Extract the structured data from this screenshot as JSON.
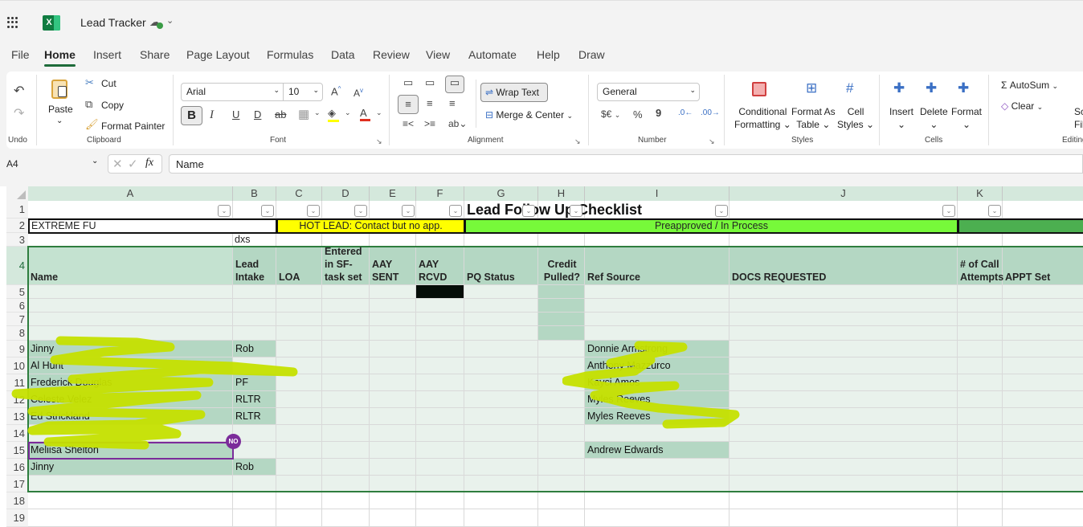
{
  "app": {
    "title": "Lead Tracker",
    "logo_letter": "X",
    "save_status": "saved-to-cloud"
  },
  "menu_tabs": [
    {
      "label": "File",
      "active": false
    },
    {
      "label": "Home",
      "active": true
    },
    {
      "label": "Insert",
      "active": false
    },
    {
      "label": "Share",
      "active": false
    },
    {
      "label": "Page Layout",
      "active": false
    },
    {
      "label": "Formulas",
      "active": false
    },
    {
      "label": "Data",
      "active": false
    },
    {
      "label": "Review",
      "active": false
    },
    {
      "label": "View",
      "active": false
    },
    {
      "label": "Automate",
      "active": false
    },
    {
      "label": "Help",
      "active": false
    },
    {
      "label": "Draw",
      "active": false
    }
  ],
  "ribbon": {
    "undo": {
      "group": "Undo"
    },
    "clipboard": {
      "paste": "Paste",
      "cut": "Cut",
      "copy": "Copy",
      "format_painter": "Format Painter",
      "group": "Clipboard"
    },
    "font": {
      "name": "Arial",
      "size": "10",
      "bold": "B",
      "italic": "I",
      "underline": "U",
      "double_underline": "D",
      "strike": "ab",
      "grow": "A^",
      "shrink": "A˅",
      "fill_color": "#ffff00",
      "font_color": "#e03020",
      "group": "Font"
    },
    "alignment": {
      "wrap_text": "Wrap Text",
      "merge_center": "Merge & Center",
      "group": "Alignment"
    },
    "number": {
      "format": "General",
      "currency": "$€",
      "percent": "%",
      "comma": "9",
      "group": "Number"
    },
    "styles": {
      "conditional": [
        "Conditional",
        "Formatting"
      ],
      "format_table": [
        "Format As",
        "Table"
      ],
      "cell_styles": [
        "Cell",
        "Styles"
      ],
      "group": "Styles"
    },
    "cells": {
      "insert": "Insert",
      "delete": "Delete",
      "format": "Format",
      "group": "Cells"
    },
    "editing": {
      "autosum": "AutoSum",
      "clear": "Clear",
      "sort_filter": [
        "Sc",
        "Fil"
      ],
      "group": "Editing"
    }
  },
  "formula_bar": {
    "name_box": "A4",
    "formula": "Name"
  },
  "sheet": {
    "columns": [
      "A",
      "B",
      "C",
      "D",
      "E",
      "F",
      "G",
      "H",
      "I",
      "J",
      "K",
      ""
    ],
    "rows": [
      "1",
      "2",
      "3",
      "4",
      "5",
      "6",
      "7",
      "8",
      "9",
      "10",
      "11",
      "12",
      "13",
      "14",
      "15",
      "16",
      "17",
      "18",
      "19"
    ],
    "title": "Lead Follow Up Checklist",
    "legend": {
      "extreme": "EXTREME FU",
      "hot": "HOT LEAD: Contact but no app.",
      "preapproved": "Preapproved / In Process",
      "hot_color": "#ffff00",
      "preapproved_color": "#77f93a",
      "dark_color": "#4caf50"
    },
    "b3": "dxs",
    "headers": {
      "A": "Name",
      "B": "Lead Intake",
      "C": "LOA",
      "D": "Entered in SF-task set",
      "E": "AAY SENT",
      "F": "AAY RCVD",
      "G": "PQ Status",
      "H": "Credit Pulled?",
      "I": "Ref Source",
      "J": "DOCS REQUESTED",
      "K": "# of Call Attempts",
      "L": "APPT Set"
    },
    "data_rows": [
      {
        "row": "9",
        "name": "Jinny",
        "intake": "Rob",
        "ref": "Donnie Armstrong"
      },
      {
        "row": "10",
        "name": "Al Hunt",
        "intake": "",
        "ref": "Anthony Mazzurco"
      },
      {
        "row": "11",
        "name": "Frederick Douglas",
        "intake": "PF",
        "ref": "Kayci Amos"
      },
      {
        "row": "12",
        "name": "Celeste Velez",
        "intake": "RLTR",
        "ref": "Myles Reeves"
      },
      {
        "row": "13",
        "name": "Ed Strickland",
        "intake": "RLTR",
        "ref": "Myles Reeves"
      },
      {
        "row": "14",
        "name": "",
        "intake": "",
        "ref": ""
      },
      {
        "row": "15",
        "name": "Meliisa Shelton",
        "intake": "",
        "ref": "Andrew Edwards"
      },
      {
        "row": "16",
        "name": "Jinny",
        "intake": "Rob",
        "ref": ""
      }
    ],
    "collab_badge": "NO",
    "collab_color": "#7b2c9a",
    "accent": "#1e6b3a",
    "band_light": "#e9f2ec",
    "band_mid": "#b4d7c3"
  }
}
